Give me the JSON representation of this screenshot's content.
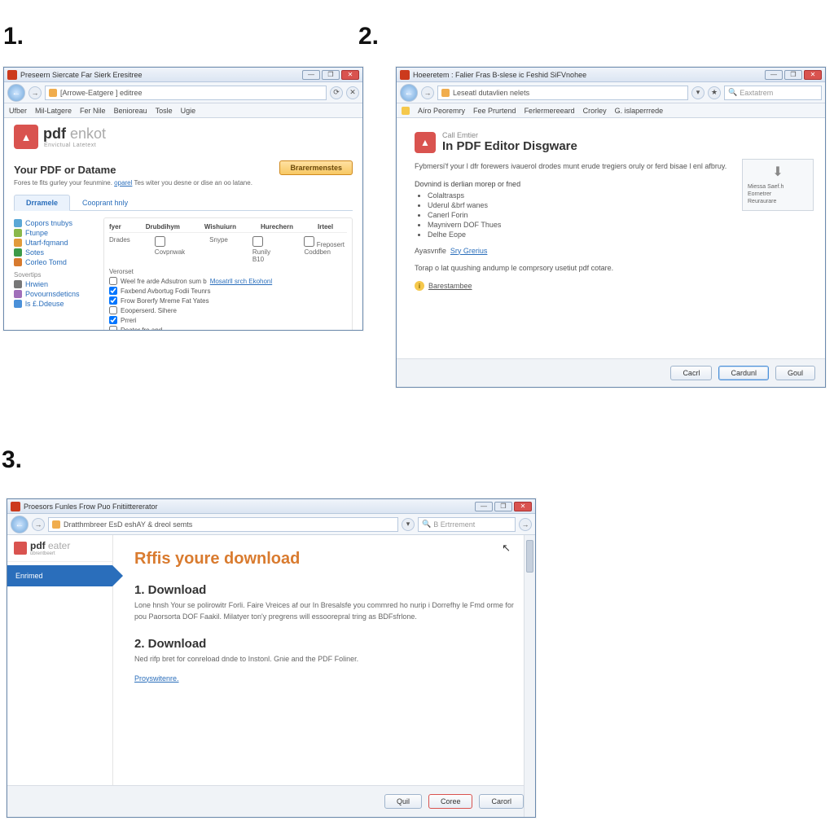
{
  "steps": {
    "s1": "1.",
    "s2": "2.",
    "s3": "3."
  },
  "win_controls": {
    "min": "—",
    "max": "❐",
    "close": "✕"
  },
  "nav": {
    "back": "←",
    "fwd": "→"
  },
  "w1": {
    "title": "Preseern Siercate Far Sierk Eresitree",
    "addr_text": "[Arrowe-Eatgere ] editree",
    "menu": [
      "Ufber",
      "Mil-Latgere",
      "Fer Nile",
      "Benioreau",
      "Tosle",
      "Ugie"
    ],
    "logo_main": "pdf",
    "logo_lite": "enkot",
    "logo_sub": "Envictual Latetext",
    "heading": "Your PDF or Datame",
    "primary_btn": "Brarermenstes",
    "description_pre": "Fores te fits gurley your feunmine. ",
    "description_link": "oparel",
    "description_post": " Tes witer you desne or dise an oo latane.",
    "tabs": {
      "active": "Drramele",
      "other": "Cooprant hnly"
    },
    "sidebar": {
      "items": [
        {
          "icon": "#5aa7d6",
          "label": "Copors tnubys"
        },
        {
          "icon": "#8ab84a",
          "label": "Ftunpe"
        },
        {
          "icon": "#e29b3b",
          "label": "Utarf-fqmand"
        },
        {
          "icon": "#3c9a48",
          "label": "Sotes"
        },
        {
          "icon": "#d77a2e",
          "label": "Corleo Tomd"
        }
      ],
      "group2_title": "Sovertips",
      "items2": [
        {
          "icon": "#777",
          "label": "Hrwien"
        },
        {
          "icon": "#a06fba",
          "label": "Povournsdeticns"
        },
        {
          "icon": "#4a90d9",
          "label": "ls £.Ddeuse"
        }
      ]
    },
    "table": {
      "headers": [
        "fyer",
        "Drubdihym",
        "Wishuiurn",
        "Hurechern",
        "Irteel"
      ],
      "cells": [
        "Drades",
        "Covpnwak",
        "Snype",
        "Runily B10",
        "Freposert Coddben"
      ]
    },
    "more_title": "Verorset",
    "checks": [
      {
        "checked": false,
        "label_pre": "Weel fre arde Adsutron sum b ",
        "link": "Mosatrll srch Ekohonl"
      },
      {
        "checked": true,
        "label": "Faxbend Avbortug Fodii Teunrs"
      },
      {
        "checked": true,
        "label": "Frow Borerfy Mreme Fat Yates"
      },
      {
        "checked": false,
        "label": "Eooperserd. Sihere"
      },
      {
        "checked": true,
        "label": "Prreri"
      },
      {
        "checked": false,
        "label": "Deater fre and"
      }
    ]
  },
  "w2": {
    "title": "Hoeeretem : Falier Fras B-slese ic Feshid SiFVnohee",
    "addr_text": "Leseatl dutavlien nelets",
    "search_placeholder": "Eaxtatrem",
    "menu": [
      "Aíro Peoremry",
      "Fee Prurtend",
      "Ferlermereeard",
      "Crorley",
      "G. islaperrrede"
    ],
    "sup": "Call Emtier",
    "heading": "In PDF Editor Disgware",
    "para": "Fybmersi'f your l dfr forewers ivauerol drodes munt erude tregiers oruly or ferd bisae l enl afbruy.",
    "list_title": "Dovnind is derlian morep or fned",
    "list": [
      "Colaltrasps",
      "Uderul &brf wanes",
      "Canerl Forin",
      "Maynivern DOF Thues",
      "Delhe Eope"
    ],
    "agree_label": "Ayasvnfle",
    "agree_link": "Sry Grerius",
    "footnote": "Torap o lat quushing andump le comprsory usetiut pdf cotare.",
    "note_word": "Barestambee",
    "right_box": [
      "Miessa Saef.h",
      "Eornetrer",
      "Reuraurare"
    ],
    "buttons": {
      "b1": "Cacrl",
      "b2": "Cardunl",
      "b3": "Goul"
    }
  },
  "w3": {
    "title": "Proesors Funles Frow Puo Fnitiittererator",
    "addr_text": "Dratthmbreer EsD eshAY & dreol semts",
    "search_placeholder": "B Ertrrement",
    "logo_main": "pdf",
    "logo_lite": "eater",
    "logo_sub": "ubrentbeert",
    "tab": "Enrimed",
    "heading": "Rffis youre download",
    "step1_title": "1. Download",
    "step1_text": "Lone hnsh Your se polirowitr Forli. Faire Vreices af our In Bresalsfe you commred ho nurip i Dorrefhy le Fmd orme for pou Paorsorta DOF Faakil. Milatyer ton'y pregrens will essoorepral tring as BDFsfrlone.",
    "step2_title": "2. Download",
    "step2_text": "Ned rifp bret for conreload dnde to Instonl. Gnie and the PDF Foliner.",
    "link": "Proyswitenre.",
    "buttons": {
      "b1": "Quil",
      "b2": "Coree",
      "b3": "Carorl"
    }
  }
}
